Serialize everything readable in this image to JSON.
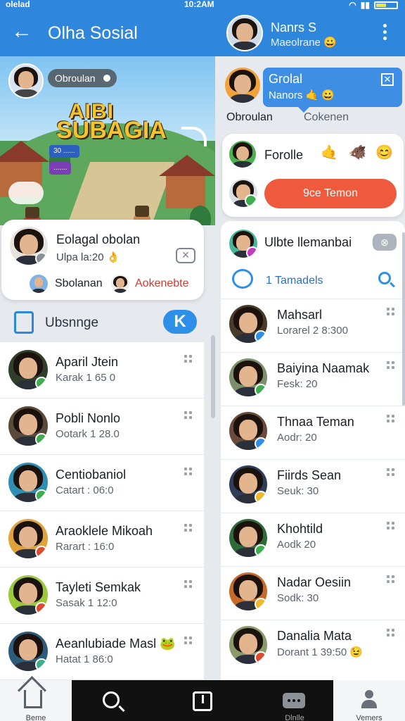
{
  "status": {
    "left": "olelad",
    "time": "10:2AM"
  },
  "header": {
    "back": "←",
    "title": "Olha Sosial",
    "user_name": "Nanrs S",
    "user_sub": "Maeolrane 😀"
  },
  "game": {
    "tag": "Obroulan",
    "logo_top": "AIBI",
    "logo_main": "SUBAGIA",
    "pill1": "30 ......",
    "pill2": "......."
  },
  "profile_card": {
    "name": "Eolagal obolan",
    "sub": "Ulpa la:20 👌",
    "close": "✕",
    "link1": "Sbolanan",
    "link2": "Aokenebte"
  },
  "left_header": {
    "title": "Ubsnnge",
    "action": "K"
  },
  "left_list": [
    {
      "name": "Aparil Jtein",
      "sub": "Karak 1 65 0",
      "badge": "#3fae4f",
      "face": "#2f3f2a"
    },
    {
      "name": "Pobli Nonlo",
      "sub": "Ootark 1 28.0",
      "badge": "#3fae4f",
      "face": "#5a4a3a"
    },
    {
      "name": "Centiobaniol",
      "sub": "Catart : 06:0",
      "badge": "#3fae4f",
      "face": "#2f8fb2"
    },
    {
      "name": "Araoklele Mikoah",
      "sub": "Rarart : 16:0",
      "badge": "#e1492f",
      "face": "#e0a23a"
    },
    {
      "name": "Tayleti Semkak",
      "sub": "Sasak 1 12:0",
      "badge": "#e1492f",
      "face": "#9bc83a"
    },
    {
      "name": "Aeanlubiade Masl 🐸",
      "sub": "Hatat 1 86:0",
      "badge": "#3fae8a",
      "face": "#2d5b7a"
    }
  ],
  "group_chat": {
    "title": "Grolal",
    "sub": "Nanors 🤙 😀",
    "close": "✕",
    "left_label": "Obroulan",
    "right_label": "Cokenen"
  },
  "right_card": {
    "name": "Forolle",
    "e1": "🤙",
    "e2": "🐗",
    "e3": "😊",
    "button": "9ce Temon"
  },
  "right_panel": {
    "title": "Ulbte llemanbai",
    "action": "⊗",
    "subtitle": "1 Tamadels"
  },
  "right_list": [
    {
      "name": "Mahsarl",
      "sub": "Lorarel 2 8:300",
      "badge": "#2e8fe8",
      "face": "#4a3a2a"
    },
    {
      "name": "Baiyina Naamak",
      "sub": "Fesk: 20",
      "badge": "#3fae4f",
      "face": "#7a8f6a"
    },
    {
      "name": "Thnaa Teman",
      "sub": "Aodr: 20",
      "badge": "#2e8fe8",
      "face": "#6a4a3a"
    },
    {
      "name": "Fiirds Sean",
      "sub": "Seuk: 30",
      "badge": "#f0b92c",
      "face": "#2f3f5a"
    },
    {
      "name": "Khohtild",
      "sub": "Aodk 20",
      "badge": "#3fae4f",
      "face": "#2f6a3a"
    },
    {
      "name": "Nadar Oesiin",
      "sub": "Sodk: 30",
      "badge": "#f0b92c",
      "face": "#c76a2a"
    },
    {
      "name": "Danalia Mata",
      "sub": "Dorant 1 39:50 😉",
      "badge": "#e1492f",
      "face": "#8a9a6a"
    }
  ],
  "nav": {
    "home": "Beme",
    "search": "",
    "post": "",
    "chat": "Dlnlle",
    "profile": "Vemers"
  },
  "colors": {
    "primary": "#2f86dd",
    "accent_button": "#ef5a3d",
    "link_red": "#d6382e"
  }
}
